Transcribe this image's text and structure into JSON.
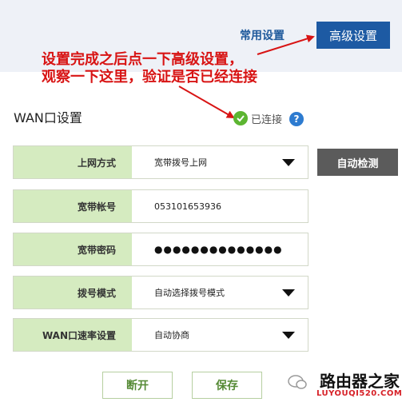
{
  "header": {
    "tab_common": "常用设置",
    "tab_advanced": "高级设置"
  },
  "annotation": {
    "line1": "设置完成之后点一下高级设置，",
    "line2": "观察一下这里，验证是否已经连接",
    "color": "#d81414"
  },
  "section": {
    "title": "WAN口设置",
    "status": "已连接",
    "help_icon_glyph": "?"
  },
  "form": {
    "rows": [
      {
        "label": "上网方式",
        "value": "宽带拨号上网",
        "type": "select"
      },
      {
        "label": "宽带帐号",
        "value": "053101653936",
        "type": "text"
      },
      {
        "label": "宽带密码",
        "value": "●●●●●●●●●●●●●●",
        "type": "password"
      },
      {
        "label": "拨号模式",
        "value": "自动选择拨号模式",
        "type": "select"
      },
      {
        "label": "WAN口速率设置",
        "value": "自动协商",
        "type": "select"
      }
    ],
    "auto_detect_label": "自动检测"
  },
  "buttons": {
    "disconnect": "断开",
    "save": "保存"
  },
  "watermark": {
    "brand": "路由器之家",
    "url": "LUYOUQI520.COM"
  },
  "colors": {
    "accent_blue": "#1d5aa3",
    "label_green": "#d5ebc0",
    "status_green": "#5cb531"
  }
}
